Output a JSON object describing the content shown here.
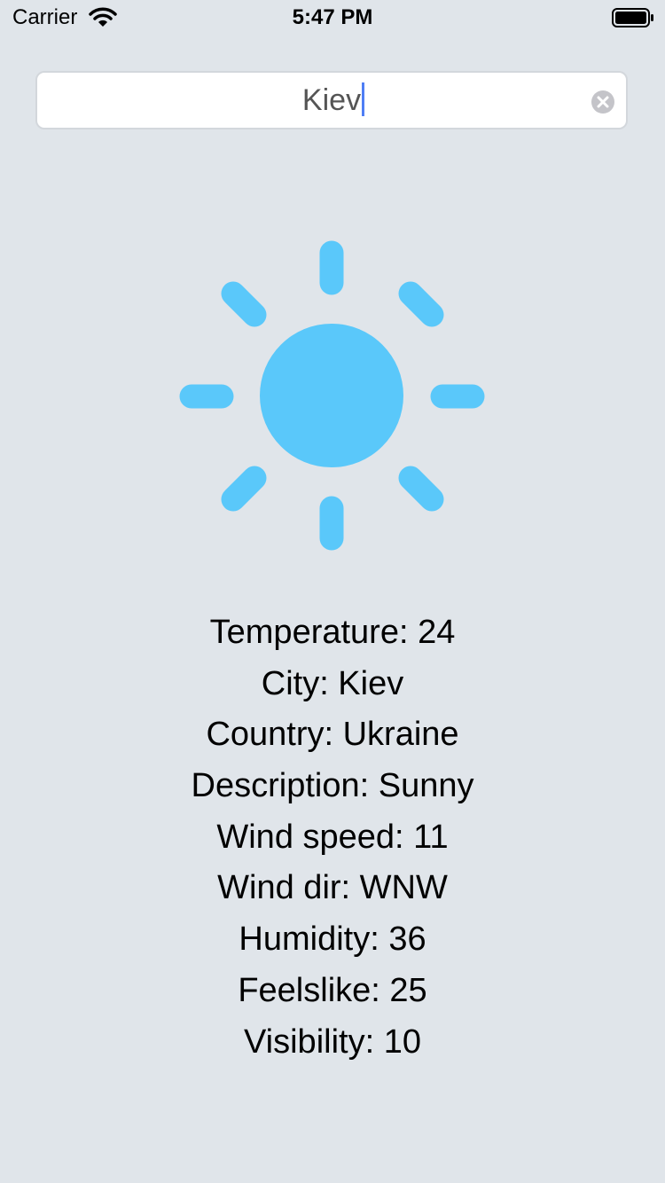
{
  "status_bar": {
    "carrier": "Carrier",
    "time": "5:47 PM"
  },
  "search": {
    "value": "Kiev"
  },
  "weather_icon": "sun-icon",
  "colors": {
    "background": "#e0e5ea",
    "accent": "#5ac8fa",
    "caret": "#4f7ef5"
  },
  "info": {
    "temperature": "Temperature: 24",
    "city": "City: Kiev",
    "country": "Country: Ukraine",
    "description": "Description: Sunny",
    "wind_speed": "Wind speed: 11",
    "wind_dir": "Wind dir: WNW",
    "humidity": "Humidity: 36",
    "feelslike": "Feelslike: 25",
    "visibility": "Visibility: 10"
  }
}
